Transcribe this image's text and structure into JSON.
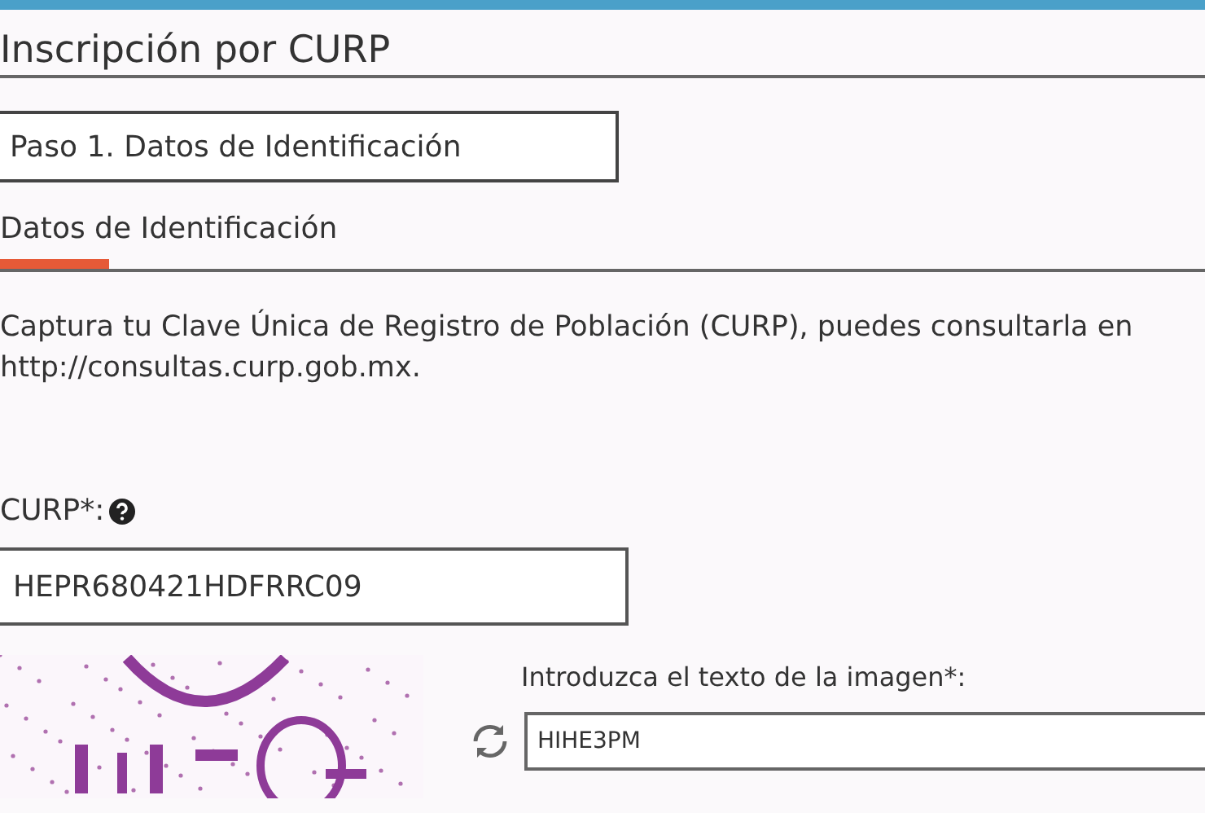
{
  "page_title": "Inscripción por CURP",
  "step": {
    "label": "Paso 1. Datos de Identificación"
  },
  "tabs": [
    {
      "label": "Datos de Identificación",
      "selected": true
    }
  ],
  "instructions": "Captura tu Clave Única de Registro de Población (CURP), puedes consultarla en  http://consultas.curp.gob.mx.",
  "curp_field": {
    "label": "CURP*:",
    "value": "HEPR680421HDFRRC09"
  },
  "captcha": {
    "label": "Introduzca el texto de la imagen*:",
    "value": "HIHE3PM"
  }
}
